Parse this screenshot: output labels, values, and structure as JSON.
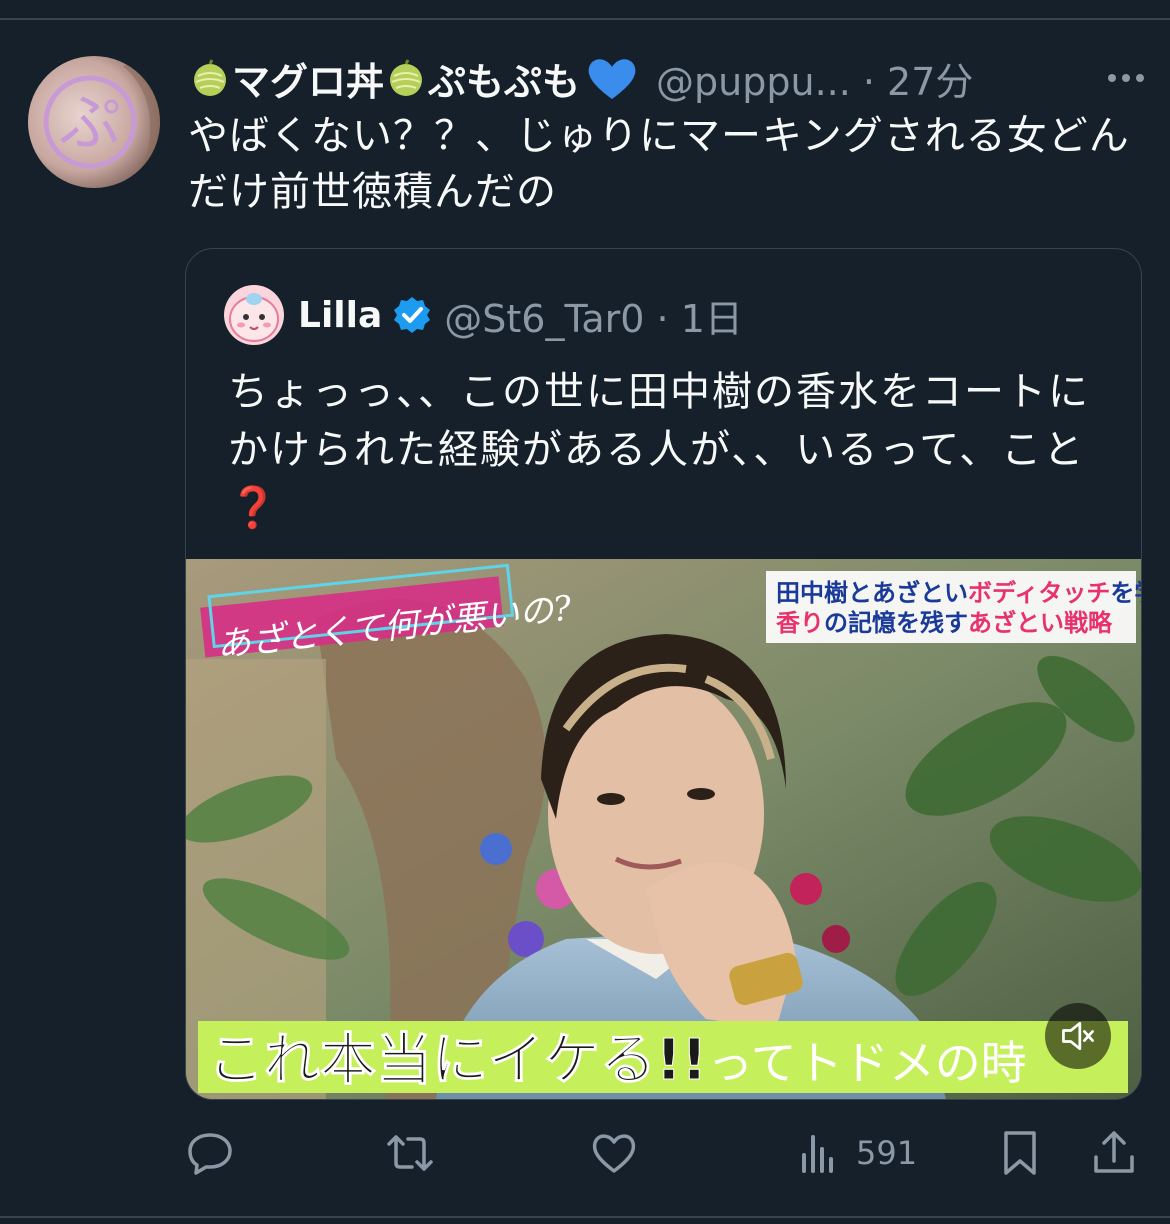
{
  "tweet": {
    "display_name_1": "マグロ丼",
    "display_name_2": "ぷもぷも",
    "handle_time": "@puppu... · 27分",
    "text": "やばくない？？、じゅりにマーキングされる女どんだけ前世徳積んだの"
  },
  "quoted": {
    "name": "Lilla",
    "handle_time": "@St6_Tar0 · 1日",
    "text": "ちょっっ、、この世に田中樹の香水をコートにかけられた経験がある人が、、いるって、こと",
    "media": {
      "show_logo": "あざとくて何が悪いの?",
      "caption_top_1a": "田中樹",
      "caption_top_1b": "とあざとい",
      "caption_top_1c": "ボディタッチ",
      "caption_top_1d": "を学ぶ!!",
      "caption_top_2a": "香り",
      "caption_top_2b": "の記憶を残す",
      "caption_top_2c": "あざとい戦略",
      "subtitle_main": "これ本当にイケる!!",
      "subtitle_rest": "ってトドメの時"
    }
  },
  "actions": {
    "views": "591"
  },
  "colors": {
    "background": "#15202b",
    "secondary_text": "#8b98a5",
    "verified_blue": "#1d9bf0",
    "heart_blue": "#3b8ded"
  }
}
